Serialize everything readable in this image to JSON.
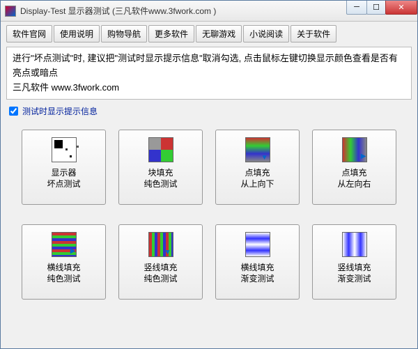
{
  "window": {
    "title": "Display-Test 显示器测试 (三凡软件www.3fwork.com )"
  },
  "toolbar": {
    "buttons": [
      "软件官网",
      "使用说明",
      "购物导航",
      "更多软件",
      "无聊游戏",
      "小说阅读",
      "关于软件"
    ]
  },
  "info": {
    "line1": "进行\"坏点测试\"时, 建议把\"测试时显示提示信息\"取消勾选, 点击鼠标左键切换显示颜色查看是否有亮点或暗点",
    "line2": "三凡软件  www.3fwork.com"
  },
  "checkbox": {
    "checked": true,
    "label": "测试时显示提示信息"
  },
  "tests": [
    {
      "id": "bad-pixel",
      "label": "显示器\n坏点测试",
      "icon": "ic-bad"
    },
    {
      "id": "block-solid",
      "label": "块填充\n纯色测试",
      "icon": "ic-block"
    },
    {
      "id": "dot-topdown",
      "label": "点填充\n从上向下",
      "icon": "ic-down"
    },
    {
      "id": "dot-leftright",
      "label": "点填充\n从左向右",
      "icon": "ic-right"
    },
    {
      "id": "hline-solid",
      "label": "横线填充\n纯色测试",
      "icon": "ic-hline"
    },
    {
      "id": "vline-solid",
      "label": "竖线填充\n纯色测试",
      "icon": "ic-vline"
    },
    {
      "id": "hline-grad",
      "label": "横线填充\n渐变测试",
      "icon": "ic-hgrad"
    },
    {
      "id": "vline-grad",
      "label": "竖线填充\n渐变测试",
      "icon": "ic-vgrad"
    }
  ]
}
